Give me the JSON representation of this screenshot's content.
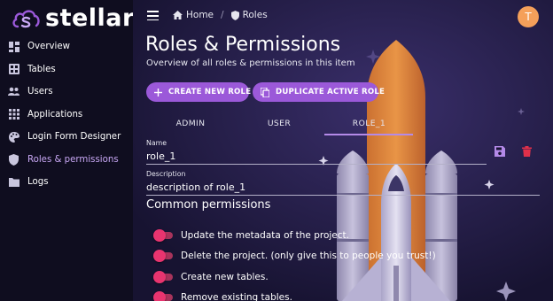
{
  "app": {
    "name": "stellar"
  },
  "sidebar": {
    "items": [
      {
        "label": "Overview",
        "icon": "dashboard-icon"
      },
      {
        "label": "Tables",
        "icon": "table-icon"
      },
      {
        "label": "Users",
        "icon": "users-icon"
      },
      {
        "label": "Applications",
        "icon": "apps-grid-icon"
      },
      {
        "label": "Login Form Designer",
        "icon": "palette-icon"
      },
      {
        "label": "Roles & permissions",
        "icon": "shield-icon",
        "active": true
      },
      {
        "label": "Logs",
        "icon": "folder-icon"
      }
    ]
  },
  "topbar": {
    "breadcrumb": [
      {
        "label": "Home",
        "icon": "home-icon"
      },
      {
        "label": "Roles",
        "icon": "shield-icon"
      }
    ],
    "avatar_initial": "T"
  },
  "page": {
    "title": "Roles & Permissions",
    "subtitle": "Overview of all roles & permissions in this item"
  },
  "actions": {
    "create_label": "CREATE NEW ROLE",
    "duplicate_label": "DUPLICATE ACTIVE ROLE"
  },
  "tabs": [
    {
      "label": "ADMIN"
    },
    {
      "label": "USER"
    },
    {
      "label": "ROLE_1",
      "active": true
    }
  ],
  "form": {
    "name_label": "Name",
    "name_value": "role_1",
    "description_label": "Description",
    "description_value": "description of role_1"
  },
  "permissions": {
    "section_title": "Common permissions",
    "items": [
      {
        "label": "Update the metadata of the project.",
        "enabled": false
      },
      {
        "label": "Delete the project. (only give this to people you trust!)",
        "enabled": false
      },
      {
        "label": "Create new tables.",
        "enabled": false
      },
      {
        "label": "Remove existing tables.",
        "enabled": false
      }
    ]
  },
  "colors": {
    "accent": "#9b59d9",
    "active_text": "#c9a8f5",
    "toggle": "#e8346f",
    "delete": "#e0304a",
    "avatar": "#f5a05a"
  }
}
